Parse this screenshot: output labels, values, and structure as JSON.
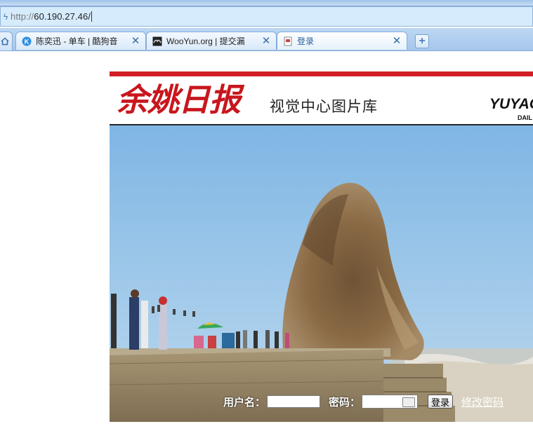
{
  "browser": {
    "address_prefix": "http://",
    "address_host": "60.190.27.46/",
    "tabs": [
      {
        "title": "陈奕迅 - 单车 | 酷狗音",
        "close": "✕"
      },
      {
        "title": "WooYun.org | 提交漏",
        "close": "✕"
      },
      {
        "title": "登录",
        "close": "✕"
      }
    ],
    "new_tab_label": "+"
  },
  "header": {
    "logo_cn": "余姚日报",
    "subtitle": "视觉中心图片库",
    "logo_en": "YUYAO",
    "logo_en_sub": "DAIL"
  },
  "login": {
    "username_label": "用户名：",
    "username_value": "",
    "password_label": "密码：",
    "password_value": "",
    "submit_label": "登录",
    "change_password_link": "修改密码"
  },
  "colors": {
    "brand_red": "#d21f26",
    "sky_blue": "#8cbde6",
    "tab_link_blue": "#3a6ea5"
  },
  "icons": {
    "home": "home-icon",
    "address_bolt": "lightning-icon",
    "tab1_favicon": "kugou-icon",
    "tab2_favicon": "wooyun-icon",
    "tab3_favicon": "page-icon",
    "keyboard": "keyboard-icon"
  }
}
